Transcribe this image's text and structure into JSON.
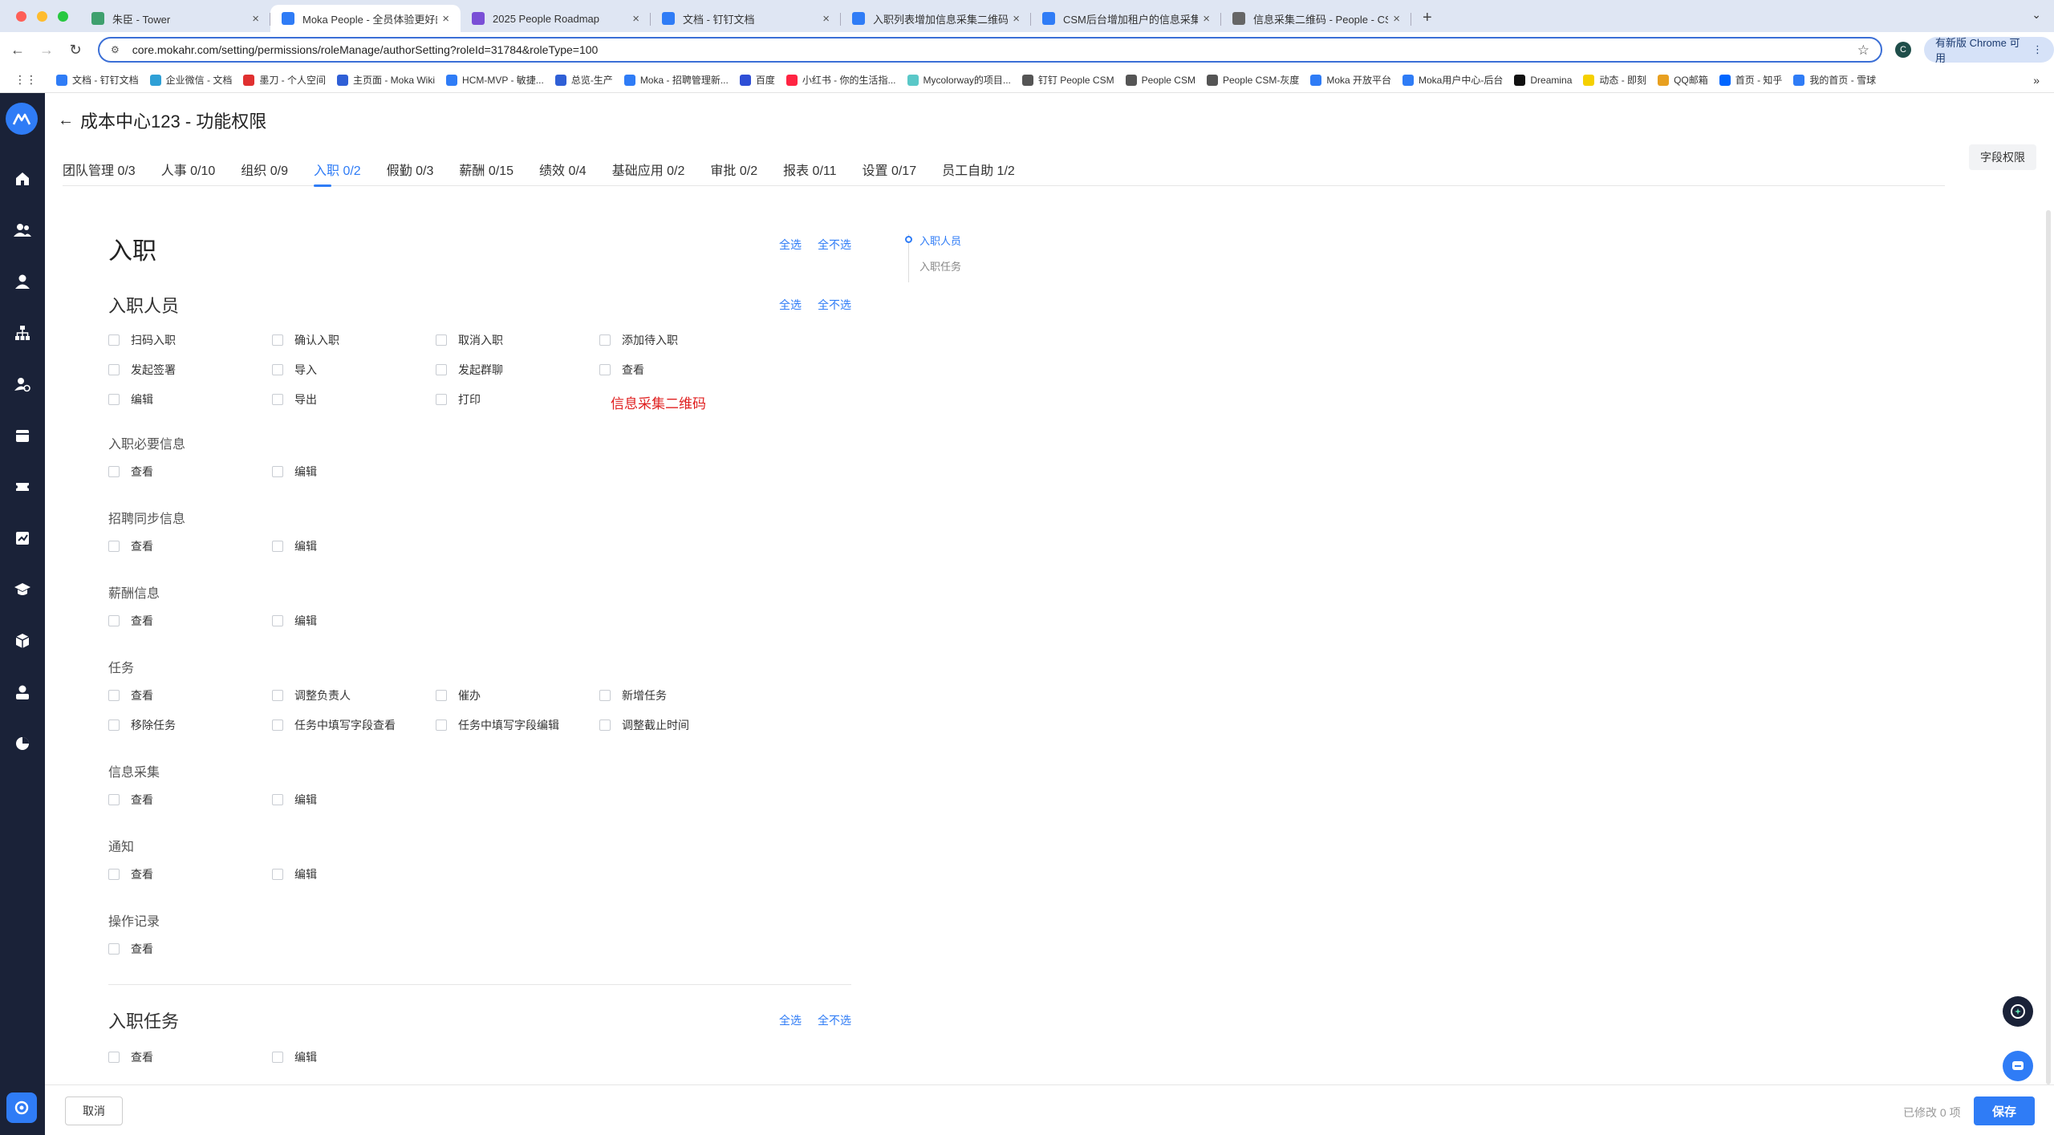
{
  "browser": {
    "tabs": [
      {
        "label": "朱臣 - Tower",
        "color": "#3fa06e"
      },
      {
        "label": "Moka People - 全员体验更好的",
        "color": "#2f7cf6"
      },
      {
        "label": "2025 People Roadmap",
        "color": "#7a4fd6"
      },
      {
        "label": "文档 - 钉钉文档",
        "color": "#2f7cf6"
      },
      {
        "label": "入职列表增加信息采集二维码 - ",
        "color": "#2f7cf6"
      },
      {
        "label": "CSM后台增加租户的信息采集二",
        "color": "#2f7cf6"
      },
      {
        "label": "信息采集二维码 - People - CSM",
        "color": "#666666"
      }
    ],
    "url": "core.mokahr.com/setting/permissions/roleManage/authorSetting?roleId=31784&roleType=100",
    "profile_initial": "C",
    "update_label": "有新版 Chrome 可用",
    "bookmarks": [
      {
        "label": "文档 - 钉钉文档",
        "color": "#2f7cf6"
      },
      {
        "label": "企业微信 - 文档",
        "color": "#2fa0d6"
      },
      {
        "label": "墨刀 - 个人空间",
        "color": "#e03030"
      },
      {
        "label": "主页面 - Moka Wiki",
        "color": "#2f5fd6"
      },
      {
        "label": "HCM-MVP - 敏捷...",
        "color": "#2f7cf6"
      },
      {
        "label": "总览-生产",
        "color": "#2f5fd6"
      },
      {
        "label": "Moka - 招聘管理新...",
        "color": "#2f7cf6"
      },
      {
        "label": "百度",
        "color": "#2f4fd6"
      },
      {
        "label": "小红书 - 你的生活指...",
        "color": "#ff2442"
      },
      {
        "label": "Mycolorway的项目...",
        "color": "#5ac8c8"
      },
      {
        "label": "钉钉 People CSM",
        "color": "#555555"
      },
      {
        "label": "People CSM",
        "color": "#555555"
      },
      {
        "label": "People CSM-灰度",
        "color": "#555555"
      },
      {
        "label": "Moka 开放平台",
        "color": "#2f7cf6"
      },
      {
        "label": "Moka用户中心-后台",
        "color": "#2f7cf6"
      },
      {
        "label": "Dreamina",
        "color": "#111111"
      },
      {
        "label": "动态 - 即刻",
        "color": "#f5d000"
      },
      {
        "label": "QQ邮箱",
        "color": "#e8a020"
      },
      {
        "label": "首页 - 知乎",
        "color": "#0066ff"
      },
      {
        "label": "我的首页 - 雪球",
        "color": "#2f7cf6"
      }
    ]
  },
  "page": {
    "title": "成本中心123 - 功能权限",
    "tabs": [
      {
        "label": "团队管理 0/3"
      },
      {
        "label": "人事 0/10"
      },
      {
        "label": "组织 0/9"
      },
      {
        "label": "入职 0/2",
        "active": true
      },
      {
        "label": "假勤 0/3"
      },
      {
        "label": "薪酬 0/15"
      },
      {
        "label": "绩效 0/4"
      },
      {
        "label": "基础应用 0/2"
      },
      {
        "label": "审批 0/2"
      },
      {
        "label": "报表 0/11"
      },
      {
        "label": "设置 0/17"
      },
      {
        "label": "员工自助 1/2"
      }
    ],
    "field_permission_label": "字段权限"
  },
  "content": {
    "section_title": "入职",
    "select_all": "全选",
    "deselect_all": "全不选",
    "onboarding_staff": {
      "title": "入职人员",
      "actions": [
        "扫码入职",
        "确认入职",
        "取消入职",
        "添加待入职",
        "发起签署",
        "导入",
        "发起群聊",
        "查看",
        "编辑",
        "导出",
        "打印"
      ],
      "annotation": "信息采集二维码"
    },
    "groups": [
      {
        "title": "入职必要信息",
        "items": [
          "查看",
          "编辑"
        ]
      },
      {
        "title": "招聘同步信息",
        "items": [
          "查看",
          "编辑"
        ]
      },
      {
        "title": "薪酬信息",
        "items": [
          "查看",
          "编辑"
        ]
      },
      {
        "title": "任务",
        "items": [
          "查看",
          "调整负责人",
          "催办",
          "新增任务",
          "移除任务",
          "任务中填写字段查看",
          "任务中填写字段编辑",
          "调整截止时间"
        ]
      },
      {
        "title": "信息采集",
        "items": [
          "查看",
          "编辑"
        ]
      },
      {
        "title": "通知",
        "items": [
          "查看",
          "编辑"
        ]
      },
      {
        "title": "操作记录",
        "items": [
          "查看"
        ]
      }
    ],
    "onboarding_tasks": {
      "title": "入职任务",
      "items": [
        "查看",
        "编辑"
      ]
    }
  },
  "anchor": {
    "items": [
      "入职人员",
      "入职任务"
    ]
  },
  "footer": {
    "cancel_label": "取消",
    "modified_label": "已修改 0 项",
    "save_label": "保存"
  }
}
